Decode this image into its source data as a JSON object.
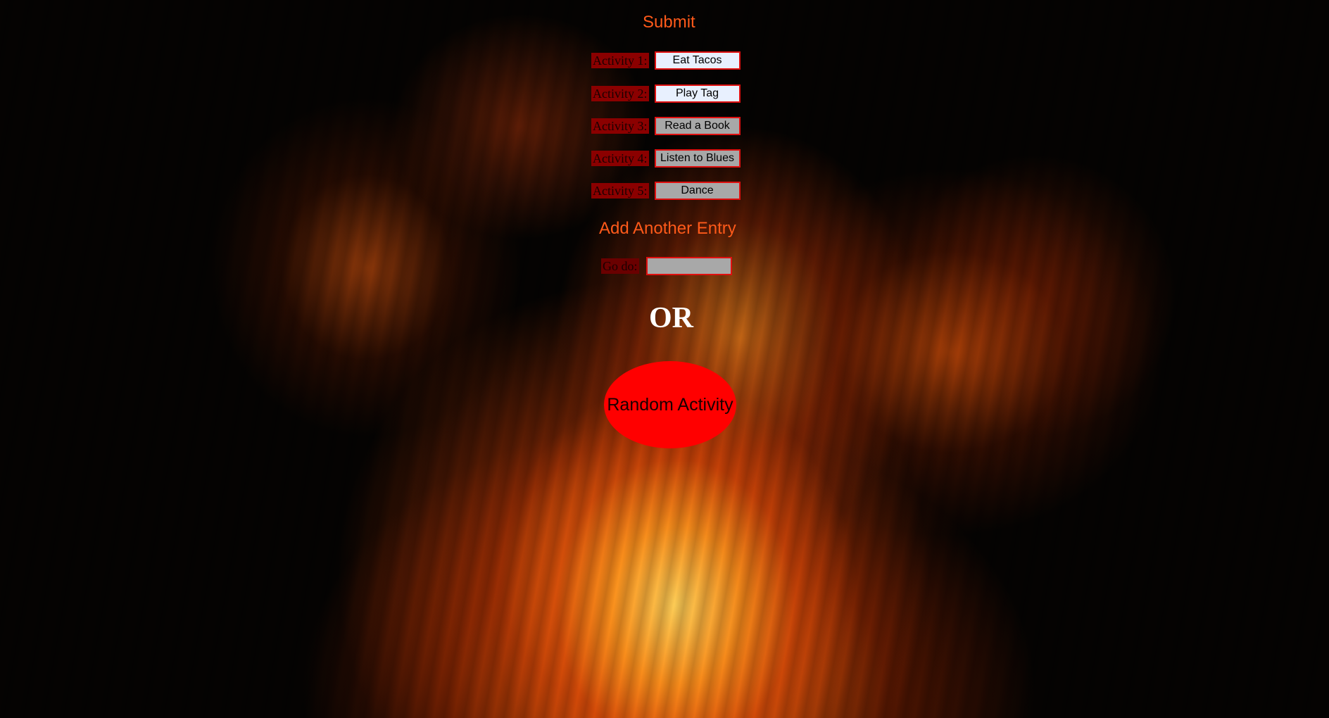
{
  "form": {
    "submit_label": "Submit",
    "activities": [
      {
        "label": "Activity 1:",
        "value": "Eat Tacos"
      },
      {
        "label": "Activity 2:",
        "value": "Play Tag"
      },
      {
        "label": "Activity 3:",
        "value": "Read a Book"
      },
      {
        "label": "Activity 4:",
        "value": "Listen to Blues"
      },
      {
        "label": "Activity 5:",
        "value": "Dance"
      }
    ],
    "add_entry_label": "Add Another Entry",
    "go_do_label": "Go do:",
    "go_do_value": ""
  },
  "or_text": "OR",
  "random_button_label": "Random Activity",
  "colors": {
    "link": "#ff5a1a",
    "input_border": "#e01010",
    "random_button": "#ff0000",
    "label_bg": "#8b0000"
  }
}
